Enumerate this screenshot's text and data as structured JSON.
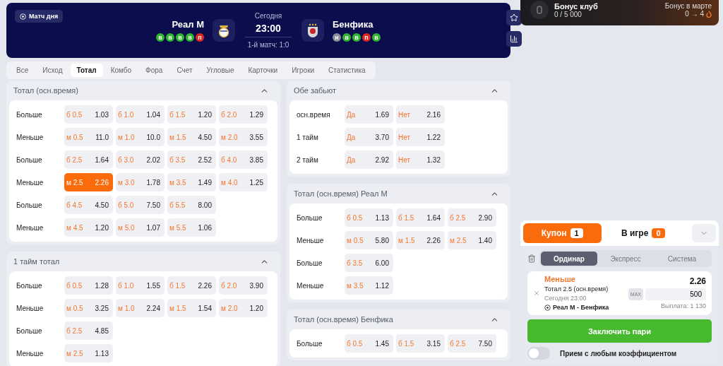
{
  "header": {
    "badge": "Матч дня",
    "home": {
      "name": "Реал М",
      "form": [
        {
          "letter": "в",
          "color": "#2fb52f"
        },
        {
          "letter": "в",
          "color": "#2fb52f"
        },
        {
          "letter": "в",
          "color": "#2fb52f"
        },
        {
          "letter": "в",
          "color": "#2fb52f"
        },
        {
          "letter": "п",
          "color": "#e0261f"
        }
      ]
    },
    "away": {
      "name": "Бенфика",
      "form": [
        {
          "letter": "н",
          "color": "#8a8d99"
        },
        {
          "letter": "в",
          "color": "#2fb52f"
        },
        {
          "letter": "в",
          "color": "#2fb52f"
        },
        {
          "letter": "п",
          "color": "#e0261f"
        },
        {
          "letter": "в",
          "color": "#2fb52f"
        }
      ]
    },
    "day": "Сегодня",
    "time": "23:00",
    "note": "1-й матч: 1:0"
  },
  "tabs": [
    {
      "label": "Все",
      "selected": false
    },
    {
      "label": "Исход",
      "selected": false
    },
    {
      "label": "Тотал",
      "selected": true
    },
    {
      "label": "Комбо",
      "selected": false
    },
    {
      "label": "Фора",
      "selected": false
    },
    {
      "label": "Счет",
      "selected": false
    },
    {
      "label": "Угловые",
      "selected": false
    },
    {
      "label": "Карточки",
      "selected": false
    },
    {
      "label": "Игроки",
      "selected": false
    },
    {
      "label": "Статистика",
      "selected": false
    }
  ],
  "markets": {
    "left": [
      {
        "title": "Тотал (осн.время)",
        "expanded": true,
        "rows": [
          {
            "label": "Больше",
            "odds": [
              {
                "name": "б 0.5",
                "value": "1.03",
                "selected": false
              },
              {
                "name": "б 1.0",
                "value": "1.04",
                "selected": false
              },
              {
                "name": "б 1.5",
                "value": "1.20",
                "selected": false
              },
              {
                "name": "б 2.0",
                "value": "1.29",
                "selected": false
              }
            ]
          },
          {
            "label": "Меньше",
            "odds": [
              {
                "name": "м 0.5",
                "value": "11.0",
                "selected": false
              },
              {
                "name": "м 1.0",
                "value": "10.0",
                "selected": false
              },
              {
                "name": "м 1.5",
                "value": "4.50",
                "selected": false
              },
              {
                "name": "м 2.0",
                "value": "3.55",
                "selected": false
              }
            ]
          },
          {
            "label": "Больше",
            "odds": [
              {
                "name": "б 2.5",
                "value": "1.64",
                "selected": false
              },
              {
                "name": "б 3.0",
                "value": "2.02",
                "selected": false
              },
              {
                "name": "б 3.5",
                "value": "2.52",
                "selected": false
              },
              {
                "name": "б 4.0",
                "value": "3.85",
                "selected": false
              }
            ]
          },
          {
            "label": "Меньше",
            "odds": [
              {
                "name": "м 2.5",
                "value": "2.26",
                "selected": true
              },
              {
                "name": "м 3.0",
                "value": "1.78",
                "selected": false
              },
              {
                "name": "м 3.5",
                "value": "1.49",
                "selected": false
              },
              {
                "name": "м 4.0",
                "value": "1.25",
                "selected": false
              }
            ]
          },
          {
            "label": "Больше",
            "odds": [
              {
                "name": "б 4.5",
                "value": "4.50",
                "selected": false
              },
              {
                "name": "б 5.0",
                "value": "7.50",
                "selected": false
              },
              {
                "name": "б 5.5",
                "value": "8.00",
                "selected": false
              }
            ]
          },
          {
            "label": "Меньше",
            "odds": [
              {
                "name": "м 4.5",
                "value": "1.20",
                "selected": false
              },
              {
                "name": "м 5.0",
                "value": "1.07",
                "selected": false
              },
              {
                "name": "м 5.5",
                "value": "1.06",
                "selected": false
              }
            ]
          }
        ]
      },
      {
        "title": "1 тайм тотал",
        "expanded": true,
        "rows": [
          {
            "label": "Больше",
            "odds": [
              {
                "name": "б 0.5",
                "value": "1.28",
                "selected": false
              },
              {
                "name": "б 1.0",
                "value": "1.55",
                "selected": false
              },
              {
                "name": "б 1.5",
                "value": "2.26",
                "selected": false
              },
              {
                "name": "б 2.0",
                "value": "3.90",
                "selected": false
              }
            ]
          },
          {
            "label": "Меньше",
            "odds": [
              {
                "name": "м 0.5",
                "value": "3.25",
                "selected": false
              },
              {
                "name": "м 1.0",
                "value": "2.24",
                "selected": false
              },
              {
                "name": "м 1.5",
                "value": "1.54",
                "selected": false
              },
              {
                "name": "м 2.0",
                "value": "1.20",
                "selected": false
              }
            ]
          },
          {
            "label": "Больше",
            "odds": [
              {
                "name": "б 2.5",
                "value": "4.85",
                "selected": false
              }
            ]
          },
          {
            "label": "Меньше",
            "odds": [
              {
                "name": "м 2.5",
                "value": "1.13",
                "selected": false
              }
            ]
          }
        ]
      }
    ],
    "right": [
      {
        "title": "Обе забьют",
        "expanded": true,
        "rows": [
          {
            "label": "осн.время",
            "odds": [
              {
                "name": "Да",
                "value": "1.69",
                "selected": false
              },
              {
                "name": "Нет",
                "value": "2.16",
                "selected": false
              }
            ]
          },
          {
            "label": "1 тайм",
            "odds": [
              {
                "name": "Да",
                "value": "3.70",
                "selected": false
              },
              {
                "name": "Нет",
                "value": "1.22",
                "selected": false
              }
            ]
          },
          {
            "label": "2 тайм",
            "odds": [
              {
                "name": "Да",
                "value": "2.92",
                "selected": false
              },
              {
                "name": "Нет",
                "value": "1.32",
                "selected": false
              }
            ]
          }
        ]
      },
      {
        "title": "Тотал (осн.время) Реал М",
        "expanded": true,
        "rows": [
          {
            "label": "Больше",
            "odds": [
              {
                "name": "б 0.5",
                "value": "1.13",
                "selected": false
              },
              {
                "name": "б 1.5",
                "value": "1.64",
                "selected": false
              },
              {
                "name": "б 2.5",
                "value": "2.90",
                "selected": false
              }
            ]
          },
          {
            "label": "Меньше",
            "odds": [
              {
                "name": "м 0.5",
                "value": "5.80",
                "selected": false
              },
              {
                "name": "м 1.5",
                "value": "2.26",
                "selected": false
              },
              {
                "name": "м 2.5",
                "value": "1.40",
                "selected": false
              }
            ]
          },
          {
            "label": "Больше",
            "odds": [
              {
                "name": "б 3.5",
                "value": "6.00",
                "selected": false
              }
            ]
          },
          {
            "label": "Меньше",
            "odds": [
              {
                "name": "м 3.5",
                "value": "1.12",
                "selected": false
              }
            ]
          }
        ]
      },
      {
        "title": "Тотал (осн.время) Бенфика",
        "expanded": true,
        "rows": [
          {
            "label": "Больше",
            "odds": [
              {
                "name": "б 0.5",
                "value": "1.45",
                "selected": false
              },
              {
                "name": "б 1.5",
                "value": "3.15",
                "selected": false
              },
              {
                "name": "б 2.5",
                "value": "7.50",
                "selected": false
              }
            ]
          }
        ]
      }
    ]
  },
  "bonus": {
    "title": "Бонус клуб",
    "progress": "0 / 5 000",
    "month": "Бонус в марте",
    "change": "0 → 4"
  },
  "coupon": {
    "tabs": [
      {
        "label": "Купон",
        "count": "1",
        "selected": true
      },
      {
        "label": "В игре",
        "count": "0",
        "selected": false
      }
    ],
    "types": [
      {
        "label": "Ординар",
        "selected": true
      },
      {
        "label": "Экспресс",
        "selected": false
      },
      {
        "label": "Система",
        "selected": false
      }
    ],
    "bet": {
      "pick": "Меньше",
      "market": "Тотал 2.5 (осн.время)",
      "when": "Сегодня 23:00",
      "match": "Реал М - Бенфика",
      "odds": "2.26",
      "max": "MAX",
      "stake": "500",
      "payout": "Выплата: 1 130"
    },
    "submit": "Заключить пари",
    "toggle": {
      "label": "Прием с любым коэффициентом",
      "on": false
    }
  }
}
